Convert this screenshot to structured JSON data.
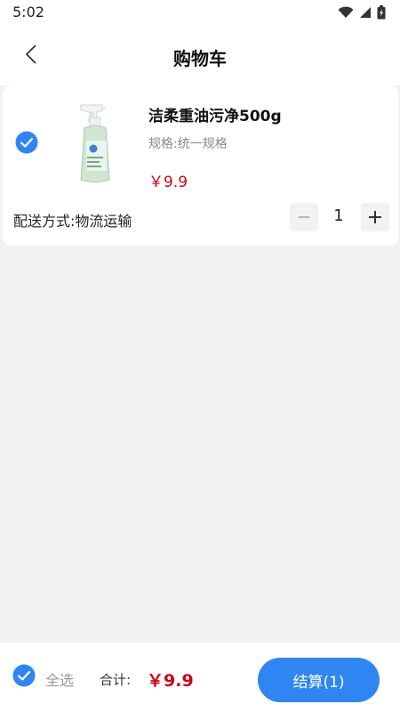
{
  "status_bar": {
    "time": "5:02"
  },
  "header": {
    "title": "购物车"
  },
  "cart": {
    "items": [
      {
        "name": "洁柔重油污净500g",
        "spec": "规格:统一规格",
        "price": "￥9.9",
        "delivery": "配送方式:物流运输",
        "quantity": "1",
        "selected": true
      }
    ]
  },
  "footer": {
    "select_all_label": "全选",
    "total_label": "合计:",
    "total_value": "￥9.9",
    "checkout_label": "结算(1)"
  },
  "colors": {
    "accent": "#2f86f2",
    "price": "#d0021b",
    "background": "#f1f2f4"
  },
  "icons": {
    "back": "chevron-left-icon",
    "check": "check-circle-icon",
    "wifi": "wifi-icon",
    "signal": "signal-icon",
    "battery": "battery-icon"
  }
}
